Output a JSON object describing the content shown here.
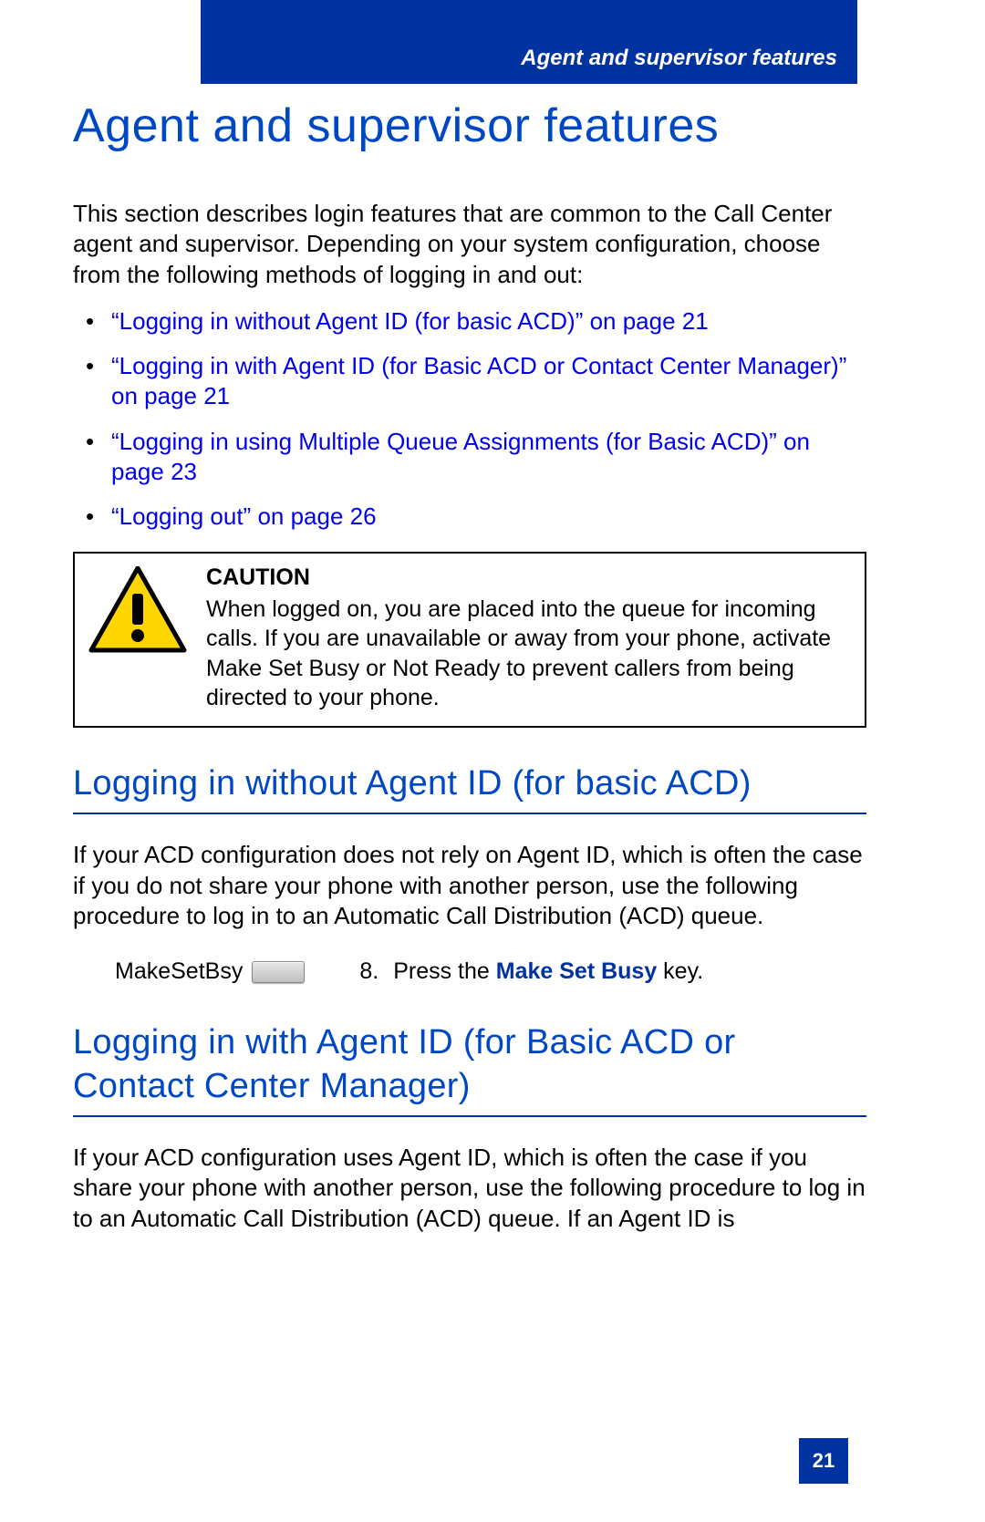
{
  "header": {
    "running_title": "Agent and supervisor features"
  },
  "title": "Agent and supervisor features",
  "intro": "This section describes login features that are common to the Call Center agent and supervisor. Depending on your system configuration, choose from the following methods of logging in and out:",
  "links": [
    "“Logging in without Agent ID (for basic ACD)” on page 21",
    "“Logging in with Agent ID (for Basic ACD or Contact Center Manager)” on page 21",
    "“Logging in using Multiple Queue Assignments (for Basic ACD)” on page 23",
    "“Logging out” on page 26"
  ],
  "caution": {
    "title": "CAUTION",
    "body": "When logged on, you are placed into the queue for incoming calls. If you are unavailable or away from your phone, activate Make Set Busy or Not Ready to prevent callers from being directed to your phone."
  },
  "section1": {
    "heading": "Logging in without Agent ID (for basic ACD)",
    "body": "If your ACD configuration does not rely on Agent ID, which is often the case if you do not share your phone with another person, use the following procedure to log in to an Automatic Call Distribution (ACD) queue."
  },
  "step": {
    "key_label": "MakeSetBsy",
    "number": "8.",
    "prefix": "Press the ",
    "emphasis": "Make Set Busy",
    "suffix": " key."
  },
  "section2": {
    "heading": "Logging in with Agent ID (for Basic ACD or Contact Center Manager)",
    "body": "If your ACD configuration uses Agent ID, which is often the case if you share your phone with another person, use the following procedure to log in to an Automatic Call Distribution (ACD) queue. If an Agent ID is"
  },
  "page_number": "21"
}
